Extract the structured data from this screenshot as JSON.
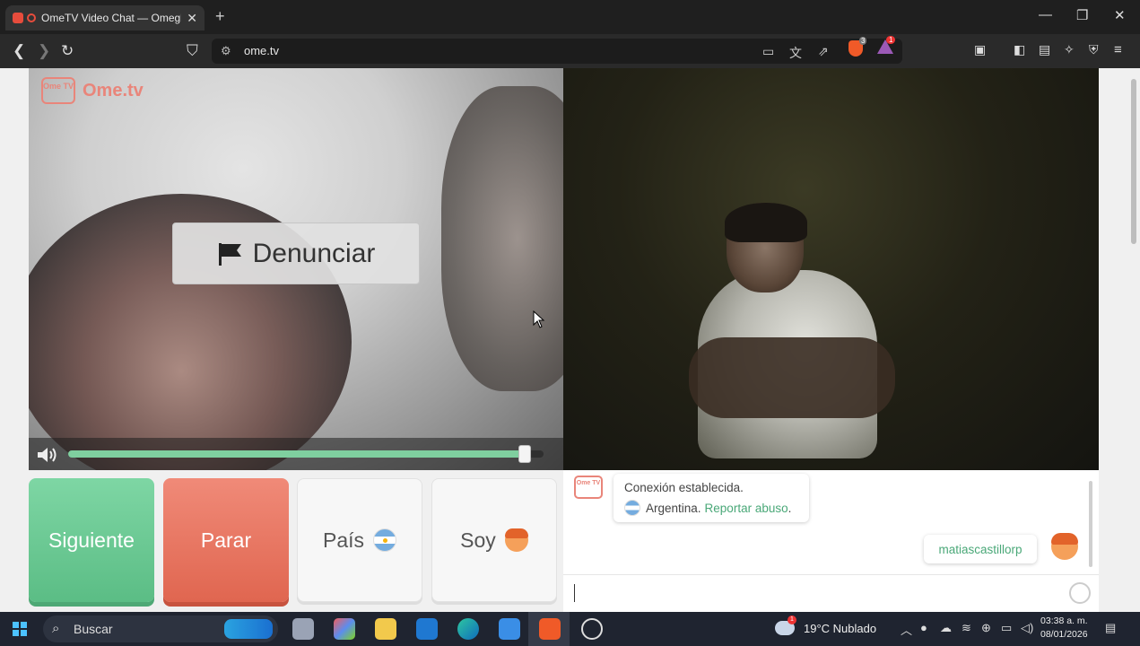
{
  "browser": {
    "tab_title": "OmeTV Video Chat — Omegle",
    "tab_close": "✕",
    "new_tab": "+",
    "url": "ome.tv",
    "brave_shield_count": "3",
    "rewards_badge": "1"
  },
  "page": {
    "logo_tv": "Ome TV",
    "logo_text": "Ome.tv",
    "report_button": "Denunciar",
    "volume_level": 0.96,
    "buttons": {
      "next": "Siguiente",
      "stop": "Parar",
      "country": "País",
      "me": "Soy"
    },
    "chat": {
      "logo": "Ome TV",
      "system_line1": "Conexión establecida.",
      "system_country": "Argentina.",
      "report_link": "Reportar abuso",
      "user_message": "matiascastillorp"
    }
  },
  "taskbar": {
    "search_label": "Buscar",
    "weather": "19°C  Nublado",
    "weather_badge": "1",
    "time": "03:38 a. m.",
    "date": "08/01/2026"
  },
  "colors": {
    "next": "#5bbd85",
    "stop": "#e06650",
    "brand": "#e9857a",
    "link": "#4aa878"
  }
}
